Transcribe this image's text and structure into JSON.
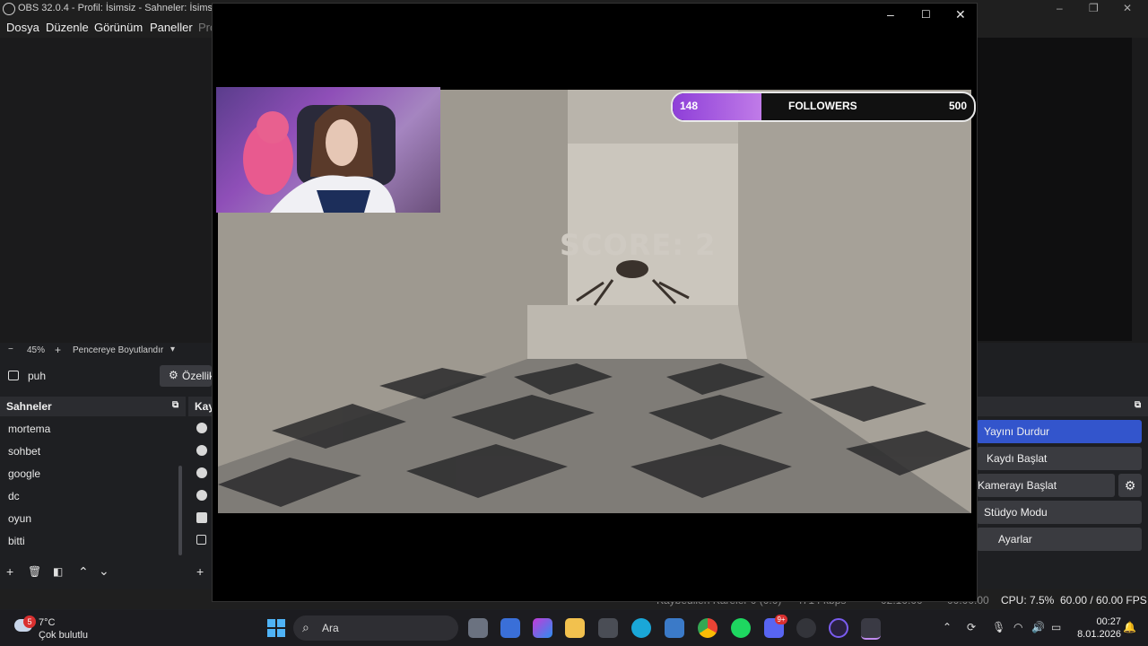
{
  "obs": {
    "title": "OBS 32.0.4 - Profil: İsimsiz - Sahneler: İsimsiz",
    "menu": [
      "Dosya",
      "Düzenle",
      "Görünüm",
      "Paneller",
      "Pro"
    ],
    "zoom": {
      "minus": "−",
      "value": "45%",
      "plus": "+",
      "fit_label": "Pencereye Boyutlandır"
    },
    "current_scene": "puh",
    "properties_label": "Özellik",
    "scenes": {
      "header": "Sahneler",
      "items": [
        "mortema",
        "sohbet",
        "google",
        "dc",
        "oyun",
        "bitti"
      ]
    },
    "sources_header": "Kay",
    "controls": {
      "stop_stream": "Yayını Durdur",
      "start_record": "Kaydı Başlat",
      "start_camera": "Kamerayı Başlat",
      "studio_mode": "Stüdyo Modu",
      "settings": "Ayarlar"
    },
    "status": {
      "dropped": "Kaybedilen Kareler 0 (0.0)",
      "kbps": "4714 kbps",
      "stream_time": "02:10:00",
      "record_time": "00:00:00",
      "cpu": "CPU: 7.5%",
      "fps": "60.00 / 60.00 FPS"
    }
  },
  "game": {
    "followers": {
      "current": "148",
      "label": "FOLLOWERS",
      "goal": "500",
      "progress": 0.296
    },
    "score_text": "SCORE: 2"
  },
  "taskbar": {
    "weather": {
      "temp": "7°C",
      "desc": "Çok bulutlu",
      "badge": "5"
    },
    "search_label": "Ara",
    "time": "00:27",
    "date": "8.01.2026",
    "discord_badge": "9+"
  },
  "colors": {
    "accent": "#3355cc",
    "followers_fill": "#b06be0"
  }
}
